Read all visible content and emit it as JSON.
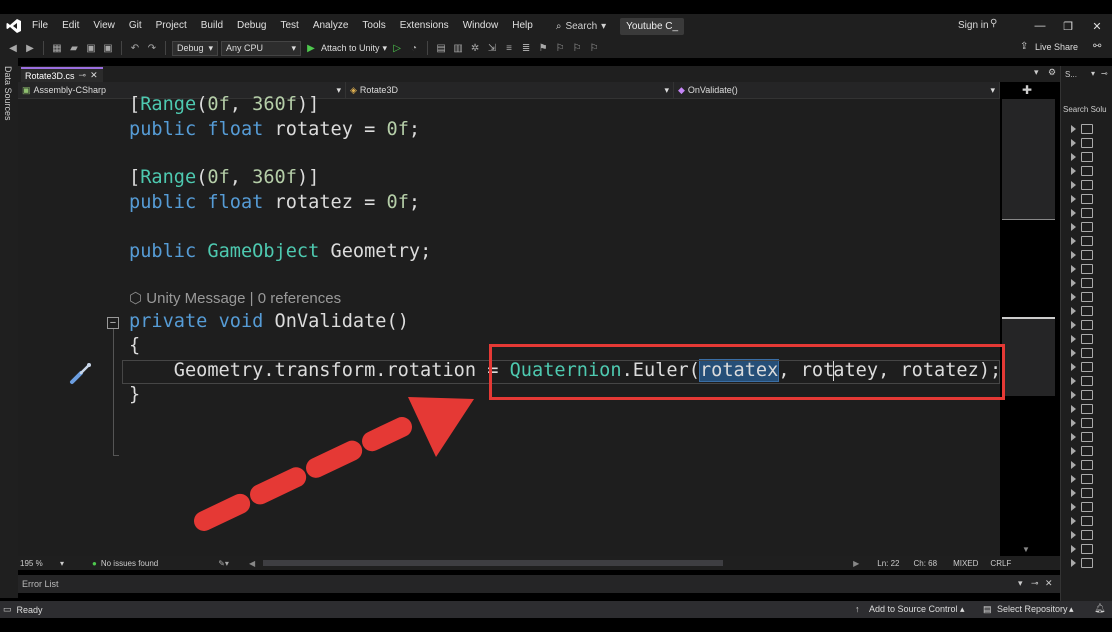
{
  "menubar": {
    "items": [
      "File",
      "Edit",
      "View",
      "Git",
      "Project",
      "Build",
      "Debug",
      "Test",
      "Analyze",
      "Tools",
      "Extensions",
      "Window",
      "Help"
    ],
    "search_label": "Search",
    "project_title": "Youtube C_",
    "sign_in": "Sign in"
  },
  "toolbar": {
    "config": "Debug",
    "platform": "Any CPU",
    "attach_label": "Attach to Unity",
    "live_share": "Live Share"
  },
  "left_strip": {
    "label": "Data Sources"
  },
  "tabs": [
    {
      "label": "Rotate3D.cs"
    }
  ],
  "navbar": {
    "project": "Assembly-CSharp",
    "class": "Rotate3D",
    "member": "OnValidate()"
  },
  "code": {
    "line1": {
      "open": "[",
      "attr": "Range",
      "args": "(",
      "a1": "0f",
      "c": ", ",
      "a2": "360f",
      "close": ")]"
    },
    "line2": {
      "kw1": "public",
      "kw2": "float",
      "name": " rotatey = ",
      "val": "0f",
      "end": ";"
    },
    "line3": {
      "open": "[",
      "attr": "Range",
      "args": "(",
      "a1": "0f",
      "c": ", ",
      "a2": "360f",
      "close": ")]"
    },
    "line4": {
      "kw1": "public",
      "kw2": "float",
      "name": " rotatez = ",
      "val": "0f",
      "end": ";"
    },
    "line5": {
      "kw1": "public",
      "type": "GameObject",
      "name": " Geometry;"
    },
    "codelens": "Unity Message | 0 references",
    "line6": {
      "kw1": "private",
      "kw2": "void",
      "name": " OnValidate()"
    },
    "line7": "{",
    "line8": {
      "lhs": "    Geometry.transform.rotation = ",
      "type": "Quaternion",
      "method": ".Euler(",
      "sel": "rotatex",
      "rest1": ", rot",
      "rest2": "atey, rotatez);"
    },
    "line9": "}"
  },
  "statusbar": {
    "zoom": "195 %",
    "issues": "No issues found",
    "ln": "Ln: 22",
    "ch": "Ch: 68",
    "mixed": "MIXED",
    "crlf": "CRLF"
  },
  "errorlist": {
    "title": "Error List"
  },
  "bottombar": {
    "ready": "Ready",
    "add_source": "Add to Source Control",
    "select_repo": "Select Repository"
  },
  "right_panel": {
    "title": "S...",
    "search": "Search Solu"
  },
  "colors": {
    "accent": "#9b6fe0",
    "annotation": "#e53935",
    "selection": "#264f78"
  }
}
